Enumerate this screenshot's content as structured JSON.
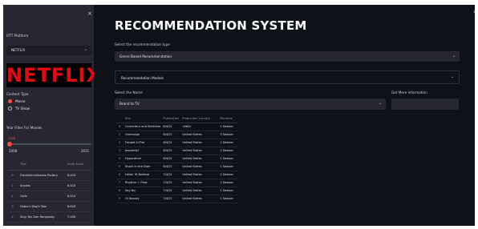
{
  "sidebar": {
    "close_glyph": "×",
    "platform_label": "OTT Platform",
    "platform_value": "NETFLIX",
    "logo_text": "NETFLIX",
    "content_type_label": "Content Type",
    "content_types": [
      {
        "label": "Movie",
        "selected": true
      },
      {
        "label": "TV Show",
        "selected": false
      }
    ],
    "slider_label": "Year Filter For Movies",
    "slider_value": "2008",
    "slider_min": "2008",
    "slider_max": "2021",
    "slider_fraction": 0.0,
    "table": {
      "headers": [
        "",
        "Title",
        "Imdb Score"
      ],
      "rows": [
        [
          "0",
          "Frankenhumbacks Factory",
          "6.410"
        ],
        [
          "1",
          "Snakes",
          "6.410"
        ],
        [
          "2",
          "Owls",
          "6.410"
        ],
        [
          "3",
          "Hubie's Dog's Tale",
          "6.620"
        ],
        [
          "4",
          "Sing Ten Dan Rangsaiky",
          "7.400"
        ]
      ]
    }
  },
  "main": {
    "menu_glyph": "≡",
    "title": "RECOMMENDATION SYSTEM",
    "rec_type_label": "Select the recommendation type",
    "rec_type_value": "Genre Based Recommendation",
    "expander_label": "Recommendation Models",
    "show_name_label": "Select the Name",
    "show_name_value": "Brand to TV",
    "info_label": "Get More Information",
    "table": {
      "headers": [
        "",
        "title",
        "Publication",
        "Production Country",
        "Duration"
      ],
      "rows": [
        [
          "0",
          "Correcteur and Sketches",
          "8/4/21",
          "<NA>",
          "1 Season"
        ],
        [
          "1",
          "Greenrige",
          "6/4/21",
          "United States",
          "3 Season"
        ],
        [
          "2",
          "Forged in Fire",
          "6/4/21",
          "United States",
          "1 Season"
        ],
        [
          "3",
          "Jeopardy!",
          "6/4/21",
          "United States",
          "1 Season"
        ],
        [
          "4",
          "Hyperdrive",
          "6/4/21",
          "United States",
          "1 Season"
        ],
        [
          "5",
          "Shark in the Dark",
          "6/4/21",
          "United States",
          "1 Season"
        ],
        [
          "6",
          "Hello! Hi-Nalimal",
          "7/4/21",
          "United States",
          "2 Season"
        ],
        [
          "7",
          "Rhythm + Flow",
          "7/4/21",
          "United States",
          "1 Season"
        ],
        [
          "8",
          "Say No",
          "7/4/21",
          "United States",
          "1 Season"
        ],
        [
          "9",
          "Oi Beauty",
          "7/4/21",
          "United States",
          "1 Season"
        ]
      ]
    }
  },
  "colors": {
    "sidebar_bg": "#262730",
    "main_bg": "#0e1117",
    "accent": "#ff4b4b",
    "netflix_red": "#e50914"
  },
  "icons": [
    "close-icon",
    "chevron-down-icon",
    "hamburger-menu-icon"
  ]
}
